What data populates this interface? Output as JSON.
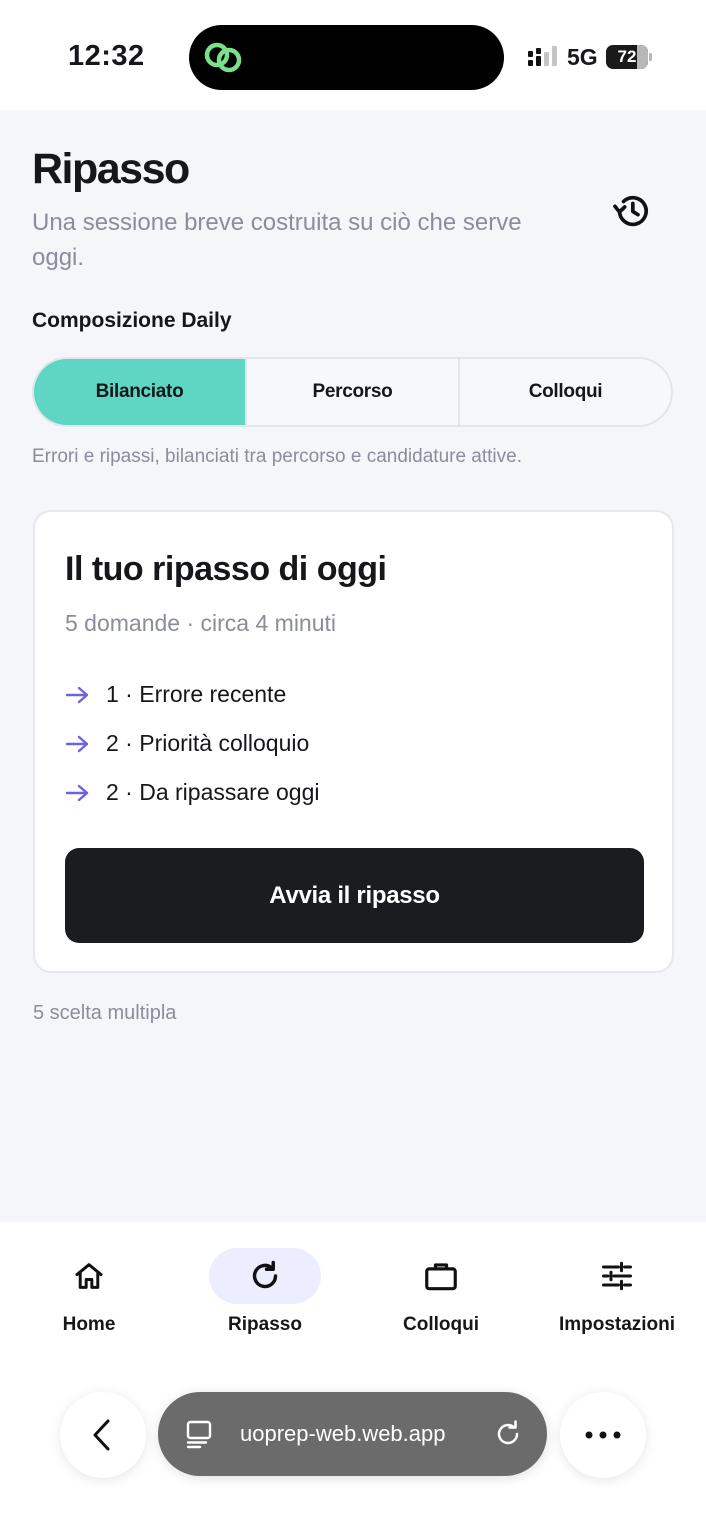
{
  "status_bar": {
    "time": "12:32",
    "network": "5G",
    "battery": "72"
  },
  "header": {
    "title": "Ripasso",
    "subtitle": "Una sessione breve costruita su ciò che serve oggi.",
    "history_icon": "history-icon"
  },
  "composition": {
    "label": "Composizione Daily",
    "options": [
      "Bilanciato",
      "Percorso",
      "Colloqui"
    ],
    "selected": "Bilanciato",
    "description": "Errori e ripassi, bilanciati tra percorso e candidature attive."
  },
  "review_card": {
    "title": "Il tuo ripasso di oggi",
    "meta": "5 domande · circa 4 minuti",
    "items": [
      "1 · Errore recente",
      "2 · Priorità colloquio",
      "2 · Da ripassare oggi"
    ],
    "start_label": "Avvia il ripasso"
  },
  "footnote": "5 scelta multipla",
  "tabbar": {
    "items": [
      {
        "label": "Home",
        "icon": "home-icon"
      },
      {
        "label": "Ripasso",
        "icon": "refresh-icon"
      },
      {
        "label": "Colloqui",
        "icon": "briefcase-icon"
      },
      {
        "label": "Impostazioni",
        "icon": "sliders-icon"
      }
    ],
    "active": "Ripasso"
  },
  "browser": {
    "url": "uoprep-web.web.app"
  },
  "colors": {
    "accent_teal": "#5fd6c3",
    "arrow_purple": "#6b63e0",
    "active_tab_bg": "#eceeff",
    "cta_bg": "#1b1c20"
  }
}
